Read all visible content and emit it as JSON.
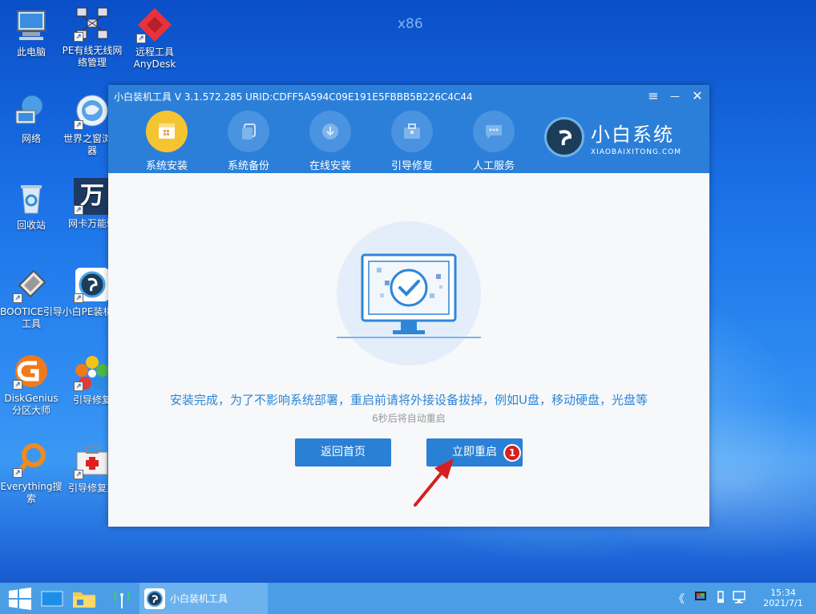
{
  "desktop": {
    "arch_label": "x86",
    "icons": [
      {
        "label": "此电脑"
      },
      {
        "label": "PE有线无线网络管理"
      },
      {
        "label": "远程工具AnyDesk"
      },
      {
        "label": "网络"
      },
      {
        "label": "世界之窗浏览器"
      },
      {
        "label": "回收站"
      },
      {
        "label": "网卡万能驱"
      },
      {
        "label": "BOOTICE引导工具"
      },
      {
        "label": "小白PE装机具"
      },
      {
        "label": "DiskGenius分区大师"
      },
      {
        "label": "引导修复"
      },
      {
        "label": "Everything搜索"
      },
      {
        "label": "引导修复工"
      }
    ],
    "wan_glyph": "万"
  },
  "window": {
    "title": "小白装机工具 V 3.1.572.285 URID:CDFF5A594C09E191E5FBBB5B226C4C44",
    "controls": {
      "menu": "≡",
      "minimize": "—",
      "close": "✕"
    },
    "nav": [
      {
        "label": "系统安装",
        "icon": "windows-icon",
        "active": true
      },
      {
        "label": "系统备份",
        "icon": "copy-icon",
        "active": false
      },
      {
        "label": "在线安装",
        "icon": "download-icon",
        "active": false
      },
      {
        "label": "引导修复",
        "icon": "toolbox-icon",
        "active": false
      },
      {
        "label": "人工服务",
        "icon": "chat-icon",
        "active": false
      }
    ],
    "brand": {
      "name_cn": "小白系统",
      "name_en": "XIAOBAIXITONG.COM"
    },
    "message": "安装完成，为了不影响系统部署，重启前请将外接设备拔掉，例如U盘，移动硬盘，光盘等",
    "countdown": "6秒后将自动重启",
    "buttons": {
      "home": "返回首页",
      "restart": "立即重启"
    },
    "badge": "1"
  },
  "taskbar": {
    "app_label": "小白装机工具",
    "tray_chevron": "《",
    "time": "15:34",
    "date": "2021/7/1"
  },
  "colors": {
    "accent": "#2b7fd8",
    "active_nav": "#f5c431",
    "badge": "#d81e1e"
  }
}
